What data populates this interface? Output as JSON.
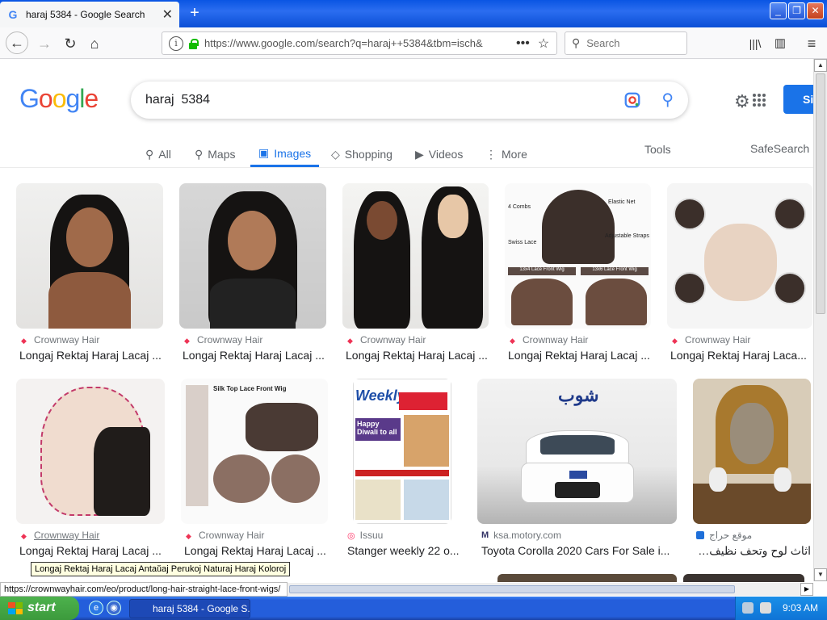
{
  "browser": {
    "tab_title": "haraj 5384 - Google Search",
    "url": "https://www.google.com/search?q=haraj++5384&tbm=isch&",
    "search_placeholder": "Search"
  },
  "google": {
    "query": "haraj  5384",
    "signin_label": "Si",
    "tabs": [
      {
        "label": "All",
        "icon": "search-icon"
      },
      {
        "label": "Maps",
        "icon": "map-pin-icon"
      },
      {
        "label": "Images",
        "icon": "image-icon"
      },
      {
        "label": "Shopping",
        "icon": "tag-icon"
      },
      {
        "label": "Videos",
        "icon": "play-icon"
      },
      {
        "label": "More",
        "icon": "more-vert-icon"
      }
    ],
    "tools_label": "Tools",
    "safesearch_label": "SafeSearch"
  },
  "results": [
    {
      "source": "Crownway Hair",
      "caption": "Longaj Rektaj Haraj Lacaj ..."
    },
    {
      "source": "Crownway Hair",
      "caption": "Longaj Rektaj Haraj Lacaj ..."
    },
    {
      "source": "Crownway Hair",
      "caption": "Longaj Rektaj Haraj Lacaj ..."
    },
    {
      "source": "Crownway Hair",
      "caption": "Longaj Rektaj Haraj Lacaj ..."
    },
    {
      "source": "Crownway Hair",
      "caption": "Longaj Rektaj Haraj Laca..."
    },
    {
      "source": "Crownway Hair",
      "caption": "Longaj Rektaj Haraj Lacaj ..."
    },
    {
      "source": "Crownway Hair",
      "caption": "Longaj Rektaj Haraj Lacaj ..."
    },
    {
      "source": "Issuu",
      "caption": "Stanger weekly 22 o..."
    },
    {
      "source": "ksa.motory.com",
      "caption": "Toyota Corolla 2020 Cars For Sale i..."
    },
    {
      "source": "موقع حراج",
      "caption": "اثاث لوح وتحف نظيف جدا !! ..."
    }
  ],
  "thumb_text": {
    "wig_labels": [
      "4 Combs",
      "Elastic Net",
      "Swiss Lace",
      "Adjustable Straps",
      "13x4 Lace Front Wig",
      "13x6 Lace Front Wig"
    ],
    "silk_title": "Silk Top Lace Front Wig",
    "newspaper_title": "Weekly",
    "newspaper_sub": "Happy Diwali to all",
    "car_brand": "شوب"
  },
  "tooltip": "Longaj Rektaj Haraj Lacaj Antaŭaj Perukoj Naturaj Haraj Koloroj",
  "status_url": "https://crownwayhair.com/eo/product/long-hair-straight-lace-front-wigs/",
  "taskbar": {
    "start_label": "start",
    "task_label": "haraj 5384 - Google S...",
    "clock": "9:03 AM"
  },
  "colors": {
    "google_blue": "#4285f4",
    "google_red": "#ea4335",
    "google_yellow": "#fbbc05",
    "google_green": "#34a853",
    "active_tab": "#1a73e8",
    "xp_taskbar": "#245edb"
  }
}
